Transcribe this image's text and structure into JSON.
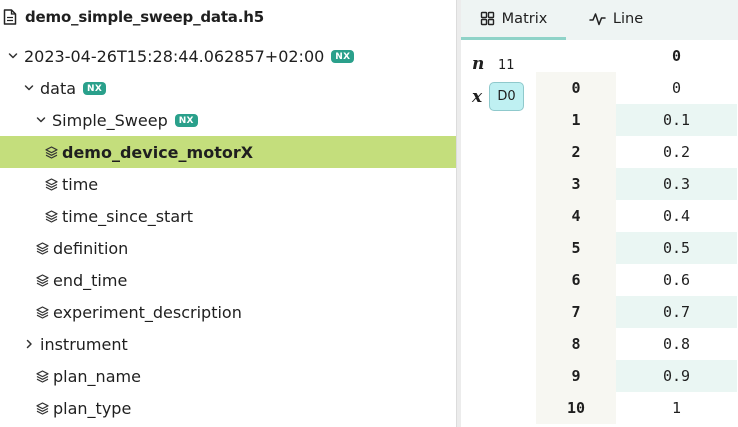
{
  "explorer": {
    "file_name": "demo_simple_sweep_data.h5",
    "nodes": [
      {
        "label": "2023-04-26T15:28:44.062857+02:00",
        "kind": "group",
        "expanded": true,
        "badge": "NX",
        "level": 0
      },
      {
        "label": "data",
        "kind": "group",
        "expanded": true,
        "badge": "NX",
        "level": 1
      },
      {
        "label": "Simple_Sweep",
        "kind": "group",
        "expanded": true,
        "badge": "NX",
        "level": 2
      },
      {
        "label": "demo_device_motorX",
        "kind": "dataset",
        "selected": true,
        "level": 3
      },
      {
        "label": "time",
        "kind": "dataset",
        "level": 3
      },
      {
        "label": "time_since_start",
        "kind": "dataset",
        "level": 3
      },
      {
        "label": "definition",
        "kind": "dataset",
        "level": 1
      },
      {
        "label": "end_time",
        "kind": "dataset",
        "level": 1
      },
      {
        "label": "experiment_description",
        "kind": "dataset",
        "level": 1
      },
      {
        "label": "instrument",
        "kind": "group",
        "expanded": false,
        "level": 1
      },
      {
        "label": "plan_name",
        "kind": "dataset",
        "level": 1
      },
      {
        "label": "plan_type",
        "kind": "dataset",
        "level": 1
      }
    ]
  },
  "visualizer": {
    "tabs": [
      {
        "label": "Matrix",
        "icon": "grid-icon",
        "active": true
      },
      {
        "label": "Line",
        "icon": "line-chart-icon",
        "active": false
      }
    ],
    "dims": {
      "n_symbol": "n",
      "n_value": "11",
      "x_symbol": "x",
      "x_axis": "D0"
    },
    "matrix": {
      "column_header": "0",
      "rows": [
        {
          "index": "0",
          "value": "0"
        },
        {
          "index": "1",
          "value": "0.1"
        },
        {
          "index": "2",
          "value": "0.2"
        },
        {
          "index": "3",
          "value": "0.3"
        },
        {
          "index": "4",
          "value": "0.4"
        },
        {
          "index": "5",
          "value": "0.5"
        },
        {
          "index": "6",
          "value": "0.6"
        },
        {
          "index": "7",
          "value": "0.7"
        },
        {
          "index": "8",
          "value": "0.8"
        },
        {
          "index": "9",
          "value": "0.9"
        },
        {
          "index": "10",
          "value": "1"
        }
      ]
    }
  },
  "colors": {
    "selected_row": "#c4de7c",
    "nx_badge": "#2aa08b",
    "active_tab_underline": "#8fd3c8",
    "d0_chip": "#bff0f2",
    "zebra_row": "#eaf6f3"
  }
}
